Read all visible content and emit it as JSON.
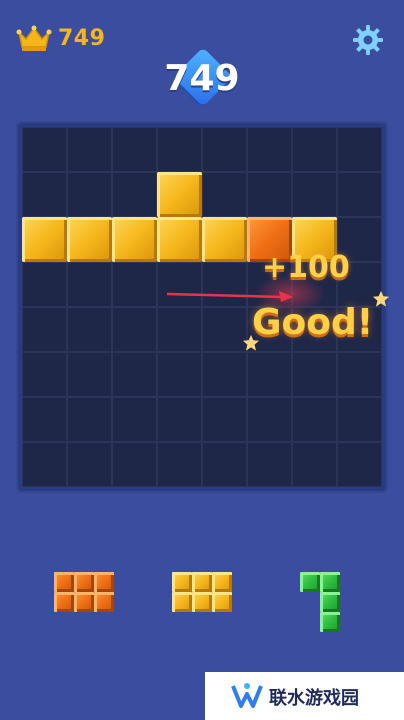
{
  "header": {
    "best_score": "749",
    "current_score": "749",
    "icons": {
      "best": "crown-icon",
      "settings": "gear-icon"
    },
    "colors": {
      "best_score": "#f5b51b",
      "score_diamond": "#2a6ee8"
    }
  },
  "board": {
    "rows": 8,
    "cols": 8,
    "filled_cells": [
      {
        "row": 1,
        "col": 3,
        "color": "yellow"
      },
      {
        "row": 2,
        "col": 0,
        "color": "yellow"
      },
      {
        "row": 2,
        "col": 1,
        "color": "yellow"
      },
      {
        "row": 2,
        "col": 2,
        "color": "yellow"
      },
      {
        "row": 2,
        "col": 3,
        "color": "yellow"
      },
      {
        "row": 2,
        "col": 4,
        "color": "yellow"
      },
      {
        "row": 2,
        "col": 5,
        "color": "orange"
      },
      {
        "row": 2,
        "col": 6,
        "color": "yellow"
      }
    ],
    "colors": {
      "board_bg": "#1f2748",
      "frame": "#2a3b85"
    }
  },
  "popup": {
    "bonus": "+100",
    "word": "Good!"
  },
  "tray": {
    "pieces": [
      {
        "name": "orange-rect-piece",
        "color": "orange",
        "shape": [
          [
            1,
            1,
            1
          ],
          [
            1,
            1,
            1
          ]
        ]
      },
      {
        "name": "yellow-rect-piece",
        "color": "yellow",
        "shape": [
          [
            1,
            1,
            1
          ],
          [
            1,
            1,
            1
          ]
        ]
      },
      {
        "name": "green-l-piece",
        "color": "green",
        "shape": [
          [
            1,
            1
          ],
          [
            0,
            1
          ],
          [
            0,
            1
          ]
        ]
      }
    ]
  },
  "footer": {
    "site": "联水游戏园",
    "icon": "logo-icon"
  }
}
